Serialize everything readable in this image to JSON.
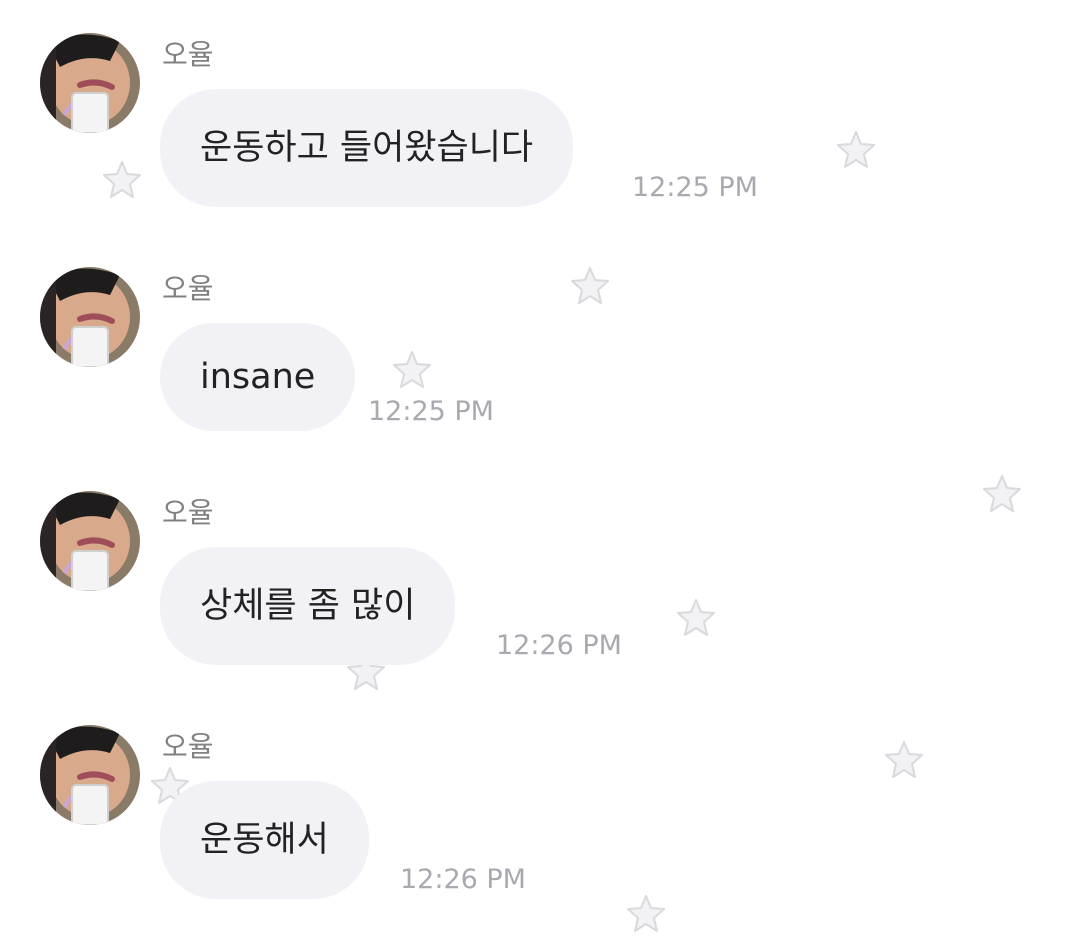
{
  "chat": {
    "messages": [
      {
        "sender": "오율",
        "text": "운동하고 들어왔습니다",
        "time": "12:25 PM"
      },
      {
        "sender": "오율",
        "text": "insane",
        "time": "12:25 PM"
      },
      {
        "sender": "오율",
        "text": "상체를 좀 많이",
        "time": "12:26 PM"
      },
      {
        "sender": "오율",
        "text": "운동해서",
        "time": "12:26 PM"
      }
    ]
  },
  "theme": {
    "bubble_color": "#f2f2f6",
    "timestamp_color": "#a9a9b0",
    "sender_color": "#808080",
    "decoration": "star-icon"
  }
}
